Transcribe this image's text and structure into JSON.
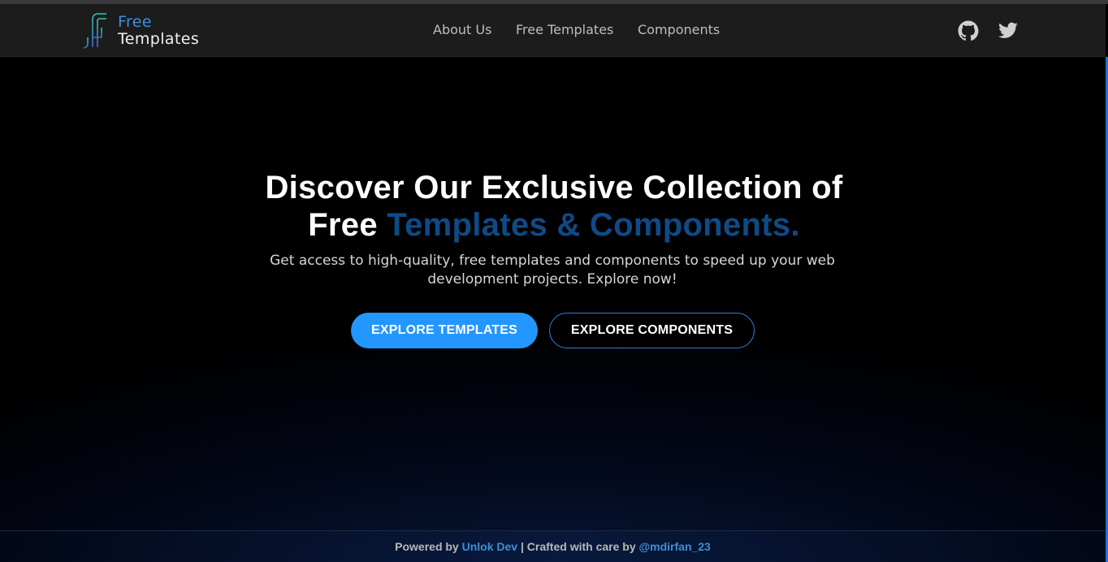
{
  "brand": {
    "line1": "Free",
    "line2": "Templates"
  },
  "nav": {
    "items": [
      {
        "label": "About Us"
      },
      {
        "label": "Free Templates"
      },
      {
        "label": "Components"
      }
    ]
  },
  "social": {
    "github_icon": "github-icon",
    "twitter_icon": "twitter-icon"
  },
  "hero": {
    "title_part1": "Discover Our Exclusive Collection of",
    "title_part2": "Free",
    "title_accent": "Templates & Components.",
    "subtitle": "Get access to high-quality, free templates and components to speed up your web development projects. Explore now!",
    "primary_button": "EXPLORE TEMPLATES",
    "secondary_button": "EXPLORE COMPONENTS"
  },
  "footer": {
    "powered_prefix": "Powered by",
    "powered_link": "Unlok Dev",
    "separator": "| Crafted with care by",
    "author_link": "@mdirfan_23"
  },
  "colors": {
    "accent_blue": "#2496ff",
    "brand_blue": "#3d8fd8",
    "title_accent": "#0e4a86",
    "navbar_bg": "#1c1c1c"
  }
}
